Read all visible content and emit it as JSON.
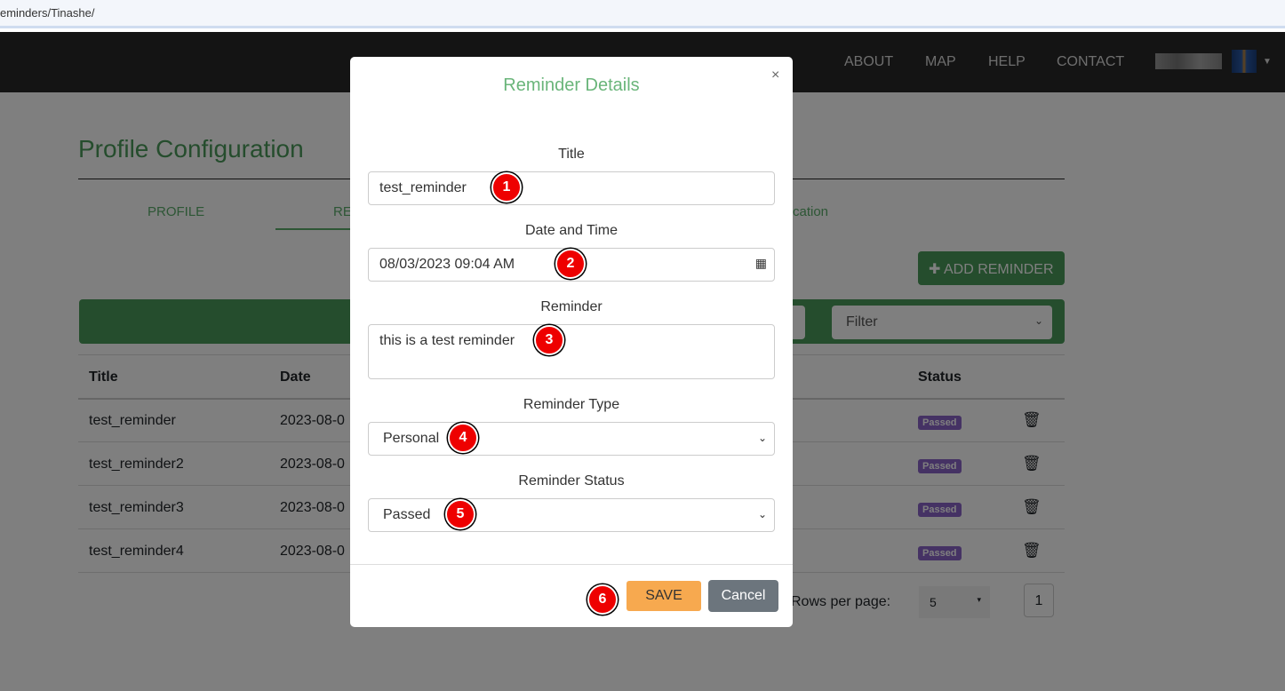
{
  "browser": {
    "url": "eminders/Tinashe/"
  },
  "nav": {
    "links": [
      "ABOUT",
      "MAP",
      "HELP",
      "CONTACT"
    ]
  },
  "page": {
    "title": "Profile Configuration",
    "tabs": [
      "PROFILE",
      "RE",
      "cation"
    ],
    "add_button": "ADD REMINDER",
    "filter": "Filter",
    "table": {
      "headers": [
        "Title",
        "Date",
        "Status"
      ],
      "rows": [
        {
          "title": "test_reminder",
          "date": "2023-08-0",
          "status": "Passed"
        },
        {
          "title": "test_reminder2",
          "date": "2023-08-0",
          "status": "Passed"
        },
        {
          "title": "test_reminder3",
          "date": "2023-08-0",
          "status": "Passed"
        },
        {
          "title": "test_reminder4",
          "date": "2023-08-0",
          "status": "Passed"
        }
      ]
    },
    "rows_per_page_label": "Rows per page:",
    "rows_per_page": "5",
    "page": "1"
  },
  "modal": {
    "title": "Reminder Details",
    "close": "×",
    "fields": {
      "title_label": "Title",
      "title_value": "test_reminder",
      "datetime_label": "Date and Time",
      "datetime_value": "08/03/2023 09:04 AM",
      "reminder_label": "Reminder",
      "reminder_value": "this is a test reminder",
      "type_label": "Reminder Type",
      "type_value": "Personal",
      "status_label": "Reminder Status",
      "status_value": "Passed"
    },
    "save": "SAVE",
    "cancel": "Cancel"
  },
  "annotations": [
    "1",
    "2",
    "3",
    "4",
    "5",
    "6"
  ],
  "colors": {
    "accent_green": "#4a9a5a",
    "badge": "#8a64c8",
    "save": "#f7a94f",
    "annotation": "#e00000"
  }
}
